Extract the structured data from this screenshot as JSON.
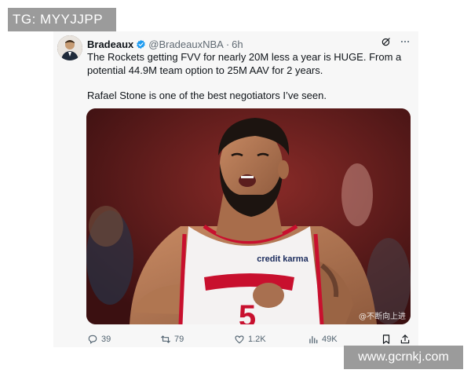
{
  "overlay": {
    "tg_label": "TG: MYYJJPP",
    "site_label": "www.gcrnkj.com"
  },
  "tweet": {
    "author": "Bradeaux",
    "handle": "@BradeauxNBA",
    "separator": "·",
    "time": "6h",
    "paragraph1": "The Rockets getting FVV for nearly 20M less a year is HUGE. From a potential 44.9M team option to 25M AAV for 2 years.",
    "paragraph2": "Rafael Stone is one of the best negotiators I’ve seen.",
    "image": {
      "jersey_sponsor": "credit karma",
      "jersey_number": "5",
      "watermark": "@不断向上进"
    },
    "metrics": {
      "replies": "39",
      "retweets": "79",
      "likes": "1.2K",
      "views": "49K"
    }
  },
  "colors": {
    "verified_blue": "#1d9bf0",
    "text_primary": "#0f1419",
    "text_secondary": "#536471",
    "jersey_red": "#c8102e"
  }
}
